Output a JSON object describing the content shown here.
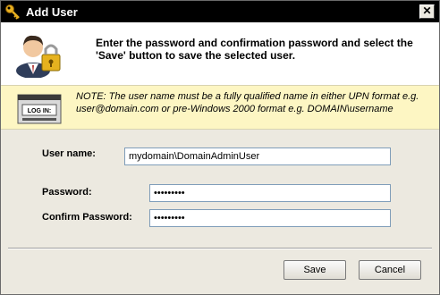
{
  "window": {
    "title": "Add User",
    "icons": {
      "title": "key-icon",
      "close": "close-icon"
    }
  },
  "header": {
    "instruction": "Enter the password and confirmation password and select the 'Save' button to save the selected user.",
    "icon": "user-lock-icon"
  },
  "note": {
    "text": "NOTE:  The user name must be a fully qualified name in either UPN format e.g. user@domain.com or pre-Windows 2000 format e.g. DOMAIN\\username",
    "icon": "login-screen-icon",
    "icon_text": "LOG IN:"
  },
  "form": {
    "username_label": "User name:",
    "username_value": "mydomain\\DomainAdminUser",
    "password_label": "Password:",
    "password_value": "•••••••••",
    "confirm_label": "Confirm Password:",
    "confirm_value": "•••••••••"
  },
  "buttons": {
    "save": "Save",
    "cancel": "Cancel"
  },
  "colors": {
    "titlebar": "#000000",
    "note_background": "#fdf6c3",
    "dialog_background": "#ece9e0"
  }
}
